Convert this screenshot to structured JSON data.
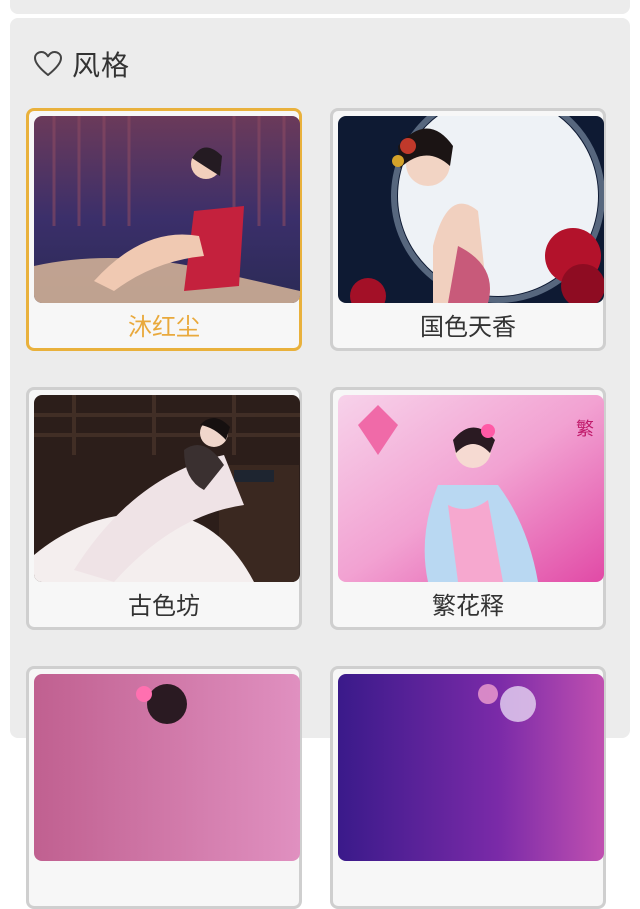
{
  "section": {
    "title": "风格",
    "icon": "heart-outline-icon"
  },
  "styles": [
    {
      "label": "沐红尘",
      "selected": true
    },
    {
      "label": "国色天香",
      "selected": false
    },
    {
      "label": "古色坊",
      "selected": false
    },
    {
      "label": "繁花释",
      "selected": false
    },
    {
      "label": "",
      "selected": false
    },
    {
      "label": "",
      "selected": false
    }
  ],
  "colors": {
    "selected_border": "#e9b13c",
    "selected_text": "#e9a93c",
    "card_border": "#cfcfcf",
    "panel_bg": "#ececec"
  }
}
